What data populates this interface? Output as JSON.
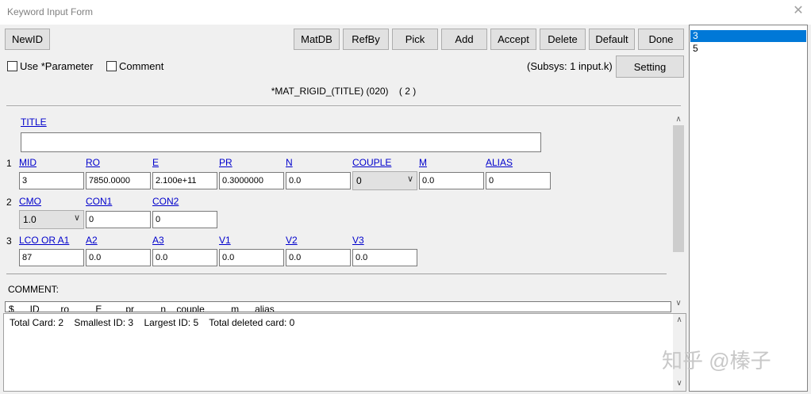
{
  "window": {
    "title": "Keyword Input Form",
    "close_glyph": "✕"
  },
  "toolbar": {
    "newid": "NewID",
    "matdb": "MatDB",
    "refby": "RefBy",
    "pick": "Pick",
    "add": "Add",
    "accept": "Accept",
    "delete": "Delete",
    "default": "Default",
    "done": "Done"
  },
  "options": {
    "use_parameter": "Use *Parameter",
    "comment": "Comment",
    "subsys": "(Subsys: 1 input.k)",
    "setting": "Setting"
  },
  "card": {
    "keyword": "*MAT_RIGID_(TITLE) (020)",
    "count": "( 2 )"
  },
  "title_field": {
    "label": "TITLE",
    "value": ""
  },
  "row1": {
    "num": "1",
    "mid": {
      "label": "MID",
      "value": "3"
    },
    "ro": {
      "label": "RO",
      "value": "7850.0000"
    },
    "e": {
      "label": "E",
      "value": "2.100e+11"
    },
    "pr": {
      "label": "PR",
      "value": "0.3000000"
    },
    "n": {
      "label": "N",
      "value": "0.0"
    },
    "couple": {
      "label": "COUPLE",
      "value": "0"
    },
    "m": {
      "label": "M",
      "value": "0.0"
    },
    "alias": {
      "label": "ALIAS",
      "value": "0"
    }
  },
  "row2": {
    "num": "2",
    "cmo": {
      "label": "CMO",
      "value": "1.0"
    },
    "con1": {
      "label": "CON1",
      "value": "0"
    },
    "con2": {
      "label": "CON2",
      "value": "0"
    }
  },
  "row3": {
    "num": "3",
    "lco": {
      "label": "LCO OR A1",
      "value": "87"
    },
    "a2": {
      "label": "A2",
      "value": "0.0"
    },
    "a3": {
      "label": "A3",
      "value": "0.0"
    },
    "v1": {
      "label": "V1",
      "value": "0.0"
    },
    "v2": {
      "label": "V2",
      "value": "0.0"
    },
    "v3": {
      "label": "V3",
      "value": "0.0"
    }
  },
  "comment": {
    "label": "COMMENT:",
    "text": "$      ID        ro          E         pr          n    couple          m      alias"
  },
  "status": {
    "total_card": "Total Card: 2",
    "smallest_id": "Smallest ID: 3",
    "largest_id": "Largest ID: 5",
    "total_deleted": "Total deleted card:  0"
  },
  "id_list": [
    {
      "label": "3",
      "selected": true
    },
    {
      "label": "5",
      "selected": false
    }
  ],
  "icons": {
    "dropdown": "chevron-down-icon",
    "scroll_up": "triangle-up-icon",
    "scroll_down": "triangle-down-icon"
  },
  "watermark": "知乎 @榛子",
  "colors": {
    "link": "#0000cc",
    "selection": "#0078d7",
    "button": "#e1e1e1"
  }
}
